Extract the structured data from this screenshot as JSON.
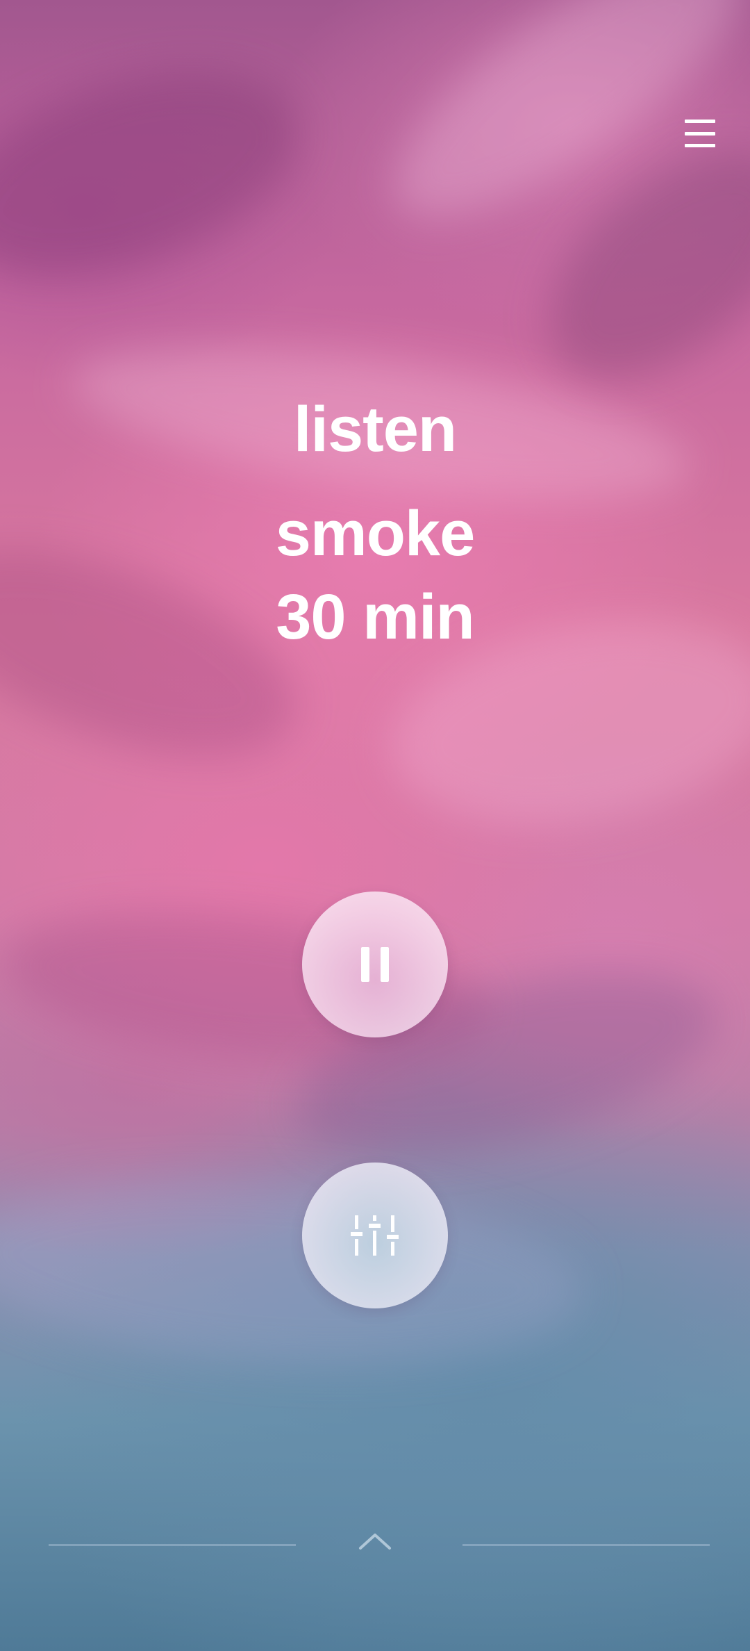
{
  "session": {
    "mode": "listen",
    "sound": "smoke",
    "duration": "30 min"
  },
  "controls": {
    "pause_icon": "pause-icon",
    "mixer_icon": "sliders-icon",
    "menu_icon": "hamburger-menu-icon",
    "expand_icon": "chevron-up-icon"
  },
  "colors": {
    "text": "#ffffff",
    "background_top": "#c6689f",
    "background_bottom": "#4f7a97"
  }
}
